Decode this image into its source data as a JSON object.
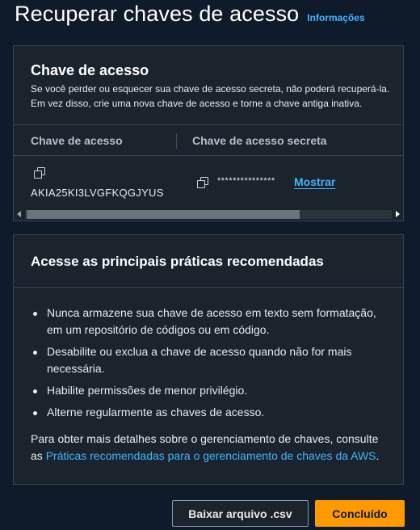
{
  "header": {
    "title": "Recuperar chaves de acesso",
    "info_link": "Informações"
  },
  "access_key_panel": {
    "title": "Chave de acesso",
    "description": "Se você perder ou esquecer sua chave de acesso secreta, não poderá recuperá-la. Em vez disso, crie uma nova chave de acesso e torne a chave antiga inativa.",
    "columns": [
      "Chave de acesso",
      "Chave de acesso secreta"
    ],
    "row": {
      "access_key_id": "AKIA25KI3LVGFKQGJYUS",
      "secret_masked": "***************",
      "show_label": "Mostrar"
    }
  },
  "best_practices": {
    "title": "Acesse as principais práticas recomendadas",
    "items": [
      "Nunca armazene sua chave de acesso em texto sem formatação, em um repositório de códigos ou em código.",
      "Desabilite ou exclua a chave de acesso quando não for mais necessária.",
      "Habilite permissões de menor privilégio.",
      "Alterne regularmente as chaves de acesso."
    ],
    "footer_prefix": "Para obter mais detalhes sobre o gerenciamento de chaves, consulte as ",
    "footer_link": "Práticas recomendadas para o gerenciamento de chaves da AWS",
    "footer_suffix": "."
  },
  "actions": {
    "download_label": "Baixar arquivo .csv",
    "done_label": "Concluído"
  },
  "colors": {
    "background": "#0f1b2a",
    "panel": "#1b232d",
    "link": "#42b4ff",
    "primary": "#ff9900"
  }
}
